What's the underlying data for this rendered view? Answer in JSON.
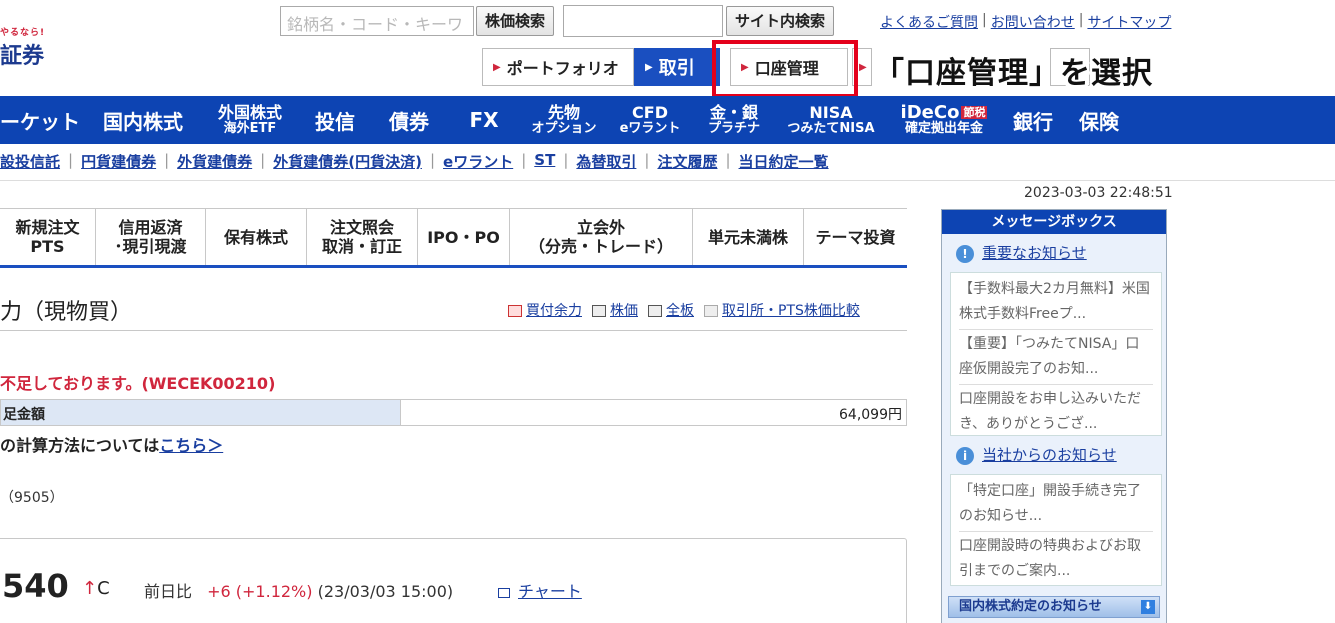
{
  "header": {
    "logo_small": "やるなら!",
    "logo_main": "証券",
    "search_placeholder": "銘柄名・コード・キーワ",
    "stock_search_btn": "株価検索",
    "site_search_btn": "サイト内検索",
    "links": [
      "よくあるご質問",
      "お問い合わせ",
      "サイトマップ"
    ]
  },
  "tabs": {
    "portfolio": "ポートフォリオ",
    "trade": "取引",
    "account": "口座管理"
  },
  "callout": "「口座管理」を選択",
  "nav": [
    {
      "label": "ーケット"
    },
    {
      "label": "国内株式"
    },
    {
      "l1": "外国株式",
      "l2": "海外ETF"
    },
    {
      "label": "投信"
    },
    {
      "label": "債券"
    },
    {
      "label": "FX"
    },
    {
      "l1": "先物",
      "l2": "オプション"
    },
    {
      "l1": "CFD",
      "l2": "eワラント"
    },
    {
      "l1": "金・銀",
      "l2": "プラチナ"
    },
    {
      "l1": "NISA",
      "l2": "つみたてNISA"
    },
    {
      "l1": "iDeCo",
      "badge": "節税",
      "l2": "確定拠出年金"
    },
    {
      "label": "銀行"
    },
    {
      "label": "保険"
    }
  ],
  "subnav": [
    "設投信託",
    "円貨建債券",
    "外貨建債券",
    "外貨建債券(円貨決済)",
    "eワラント",
    "ST",
    "為替取引",
    "注文履歴",
    "当日約定一覧"
  ],
  "datetime": "2023-03-03 22:48:51",
  "trade_tabs": [
    {
      "l1": "新規注文",
      "l2": "PTS"
    },
    {
      "l1": "信用返済",
      "l2": "･現引現渡"
    },
    {
      "l1": "保有株式",
      "l2": ""
    },
    {
      "l1": "注文照会",
      "l2": "取消・訂正"
    },
    {
      "l1": "IPO・PO",
      "l2": ""
    },
    {
      "l1": "立会外",
      "l2": "（分売・トレード）"
    },
    {
      "l1": "単元未満株",
      "l2": ""
    },
    {
      "l1": "テーマ投資",
      "l2": ""
    }
  ],
  "section": {
    "title": "力（現物買）",
    "links": [
      "買付余力",
      "株価",
      "全板",
      "取引所・PTS株価比較"
    ]
  },
  "error_msg": "不足しております。(WECEK00210)",
  "shortage": {
    "label": "足金額",
    "value": "64,099円"
  },
  "calc": {
    "text": "の計算方法については",
    "link": "こちら＞"
  },
  "code": "（9505）",
  "price": {
    "value": "540",
    "arrow": "↑",
    "mark": "C",
    "prev_label": "前日比",
    "change": "+6 (+1.12%)",
    "time": "(23/03/03 15:00)",
    "chart_link": "チャート"
  },
  "messagebox": {
    "title": "メッセージボックス",
    "important": "重要なお知らせ",
    "important_items": [
      "【手数料最大2カ月無料】米国株式手数料Freeプ...",
      "【重要】「つみたてNISA」口座仮開設完了のお知...",
      "口座開設をお申し込みいただき、ありがとうござ..."
    ],
    "company": "当社からのお知らせ",
    "company_items": [
      "「特定口座」開設手続き完了のお知らせ...",
      "口座開設時の特典およびお取引までのご案内..."
    ],
    "domestic": "国内株式約定のお知らせ"
  }
}
